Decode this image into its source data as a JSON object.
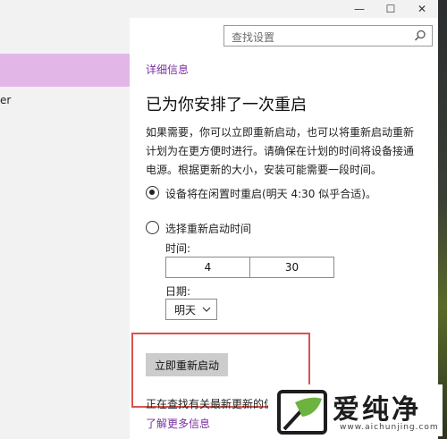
{
  "window": {
    "minimize_glyph": "—",
    "maximize_glyph": "☐",
    "close_glyph": "✕"
  },
  "sidebar": {
    "partial_item_text": "er"
  },
  "search": {
    "placeholder": "查找设置",
    "icon": "search-icon"
  },
  "content": {
    "details_link": "详细信息",
    "heading": "已为你安排了一次重启",
    "description": "如果需要，你可以立即重新启动，也可以将重新启动重新计划为在更方便时进行。请确保在计划的时间将设备接通电源。根据更新的大小，安装可能需要一段时间。",
    "option_idle": "设备将在闲置时重启(明天 4:30 似乎合适)。",
    "option_choose": "选择重新启动时间",
    "time_label": "时间:",
    "time_hour": "4",
    "time_minute": "30",
    "date_label": "日期:",
    "date_value": "明天",
    "restart_now_button": "立即重新启动",
    "status_text": "正在查找有关最新更新的信",
    "learn_more_link": "了解更多信息"
  },
  "selected_option": "option_idle",
  "colors": {
    "accent_link": "#7b2f9e",
    "sidebar_selected": "#e2b7e8",
    "highlight_frame": "#d9534f",
    "button_bg": "#cccccc"
  },
  "watermark": {
    "brand": "爱纯净",
    "url": "www.aichunjing.com",
    "logo_icon": "leaf-logo-icon"
  }
}
